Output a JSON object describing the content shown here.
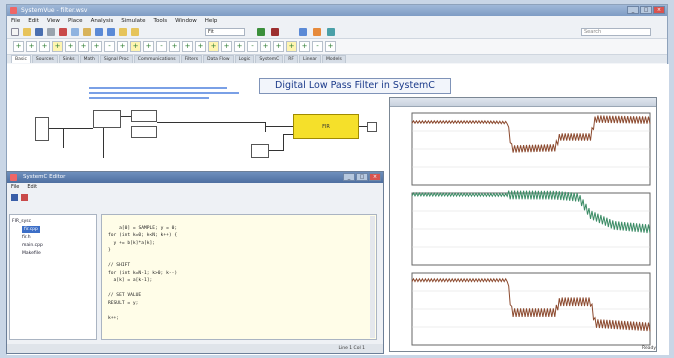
{
  "app": {
    "title": "SystemVue - filter.wsv",
    "menus": [
      "File",
      "Edit",
      "View",
      "Place",
      "Analysis",
      "Simulate",
      "Tools",
      "Window",
      "Help"
    ],
    "zoom": "Fit",
    "search_placeholder": "Search"
  },
  "toolbar": {
    "component_symbols": [
      "+",
      "+",
      "+",
      "+",
      "+",
      "+",
      "+",
      "-",
      "+",
      "+",
      "+",
      "-",
      "+",
      "+",
      "+",
      "+",
      "+",
      "+",
      "-",
      "+",
      "+",
      "+",
      "+",
      "-",
      "+"
    ]
  },
  "palette_tabs": [
    "Basic",
    "Sources",
    "Sinks",
    "Math",
    "Signal Proc",
    "Communications",
    "Filters",
    "Data Flow",
    "Logic",
    "SystemC",
    "RF",
    "Linear",
    "Models"
  ],
  "schematic": {
    "title": "Digital Low Pass Filter in SystemC"
  },
  "editor": {
    "title": "SystemC Editor",
    "menus": [
      "File",
      "Edit"
    ],
    "tree": [
      {
        "label": "FIR_sysc",
        "selected": false
      },
      {
        "label": "fir.cpp",
        "selected": true
      },
      {
        "label": "fir.h",
        "selected": false
      },
      {
        "label": "main.cpp",
        "selected": false
      },
      {
        "label": "Makefile",
        "selected": false
      }
    ],
    "code": "a[0] = SAMPLE; y = 0;\nfor (int k=0; k<N; k++) {\n  y += b[k]*a[k];\n}\n\n// SHIFT\nfor (int k=N-1; k>0; k--)\n  a[k] = a[k-1];\n\n// SET VALUE\nRESULT = y;\n\nk++;",
    "status": "Line 1  Col 1"
  },
  "main_status": "Ready",
  "colors": {
    "trace_brown": "#8c4a2f",
    "trace_green": "#3c8c66",
    "fir_block": "#f5e02a"
  },
  "chart_data": [
    {
      "type": "line",
      "title": "",
      "ylabel": "",
      "xlabel": "",
      "ylim": [
        -100,
        20
      ],
      "xlim": [
        0,
        1
      ],
      "grid": true,
      "series": [
        {
          "values": [
            [
              0,
              5
            ],
            [
              0.3,
              5
            ],
            [
              0.4,
              4
            ],
            [
              0.42,
              -40
            ],
            [
              0.6,
              -38
            ],
            [
              0.62,
              -20
            ],
            [
              0.75,
              -20
            ],
            [
              0.77,
              10
            ],
            [
              1,
              8
            ]
          ]
        }
      ]
    },
    {
      "type": "line",
      "title": "",
      "ylabel": "",
      "xlabel": "",
      "ylim": [
        -100,
        0
      ],
      "xlim": [
        0,
        1
      ],
      "grid": true,
      "series": [
        {
          "values": [
            [
              0,
              -2
            ],
            [
              0.6,
              -3
            ],
            [
              0.7,
              -6
            ],
            [
              0.75,
              -30
            ],
            [
              0.85,
              -45
            ],
            [
              1,
              -50
            ]
          ]
        }
      ]
    },
    {
      "type": "line",
      "title": "",
      "ylabel": "",
      "xlabel": "",
      "ylim": [
        -100,
        0
      ],
      "xlim": [
        0,
        1
      ],
      "grid": true,
      "series": [
        {
          "values": [
            [
              0,
              -10
            ],
            [
              0.4,
              -10
            ],
            [
              0.42,
              -55
            ],
            [
              0.6,
              -55
            ],
            [
              0.62,
              -40
            ],
            [
              0.75,
              -40
            ],
            [
              0.77,
              -70
            ],
            [
              1,
              -75
            ]
          ]
        }
      ]
    }
  ]
}
